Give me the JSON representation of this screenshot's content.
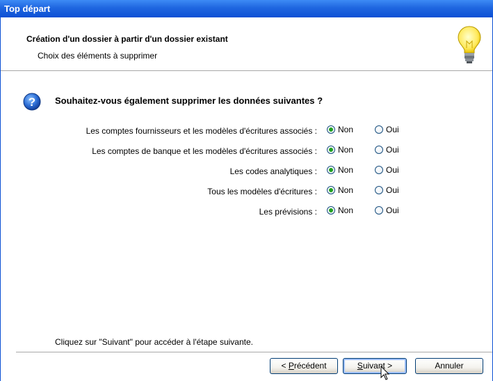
{
  "window": {
    "title": "Top départ"
  },
  "header": {
    "title": "Création d'un dossier à partir d'un dossier existant",
    "subtitle": "Choix des éléments à supprimer"
  },
  "question": "Souhaitez-vous également supprimer les données suivantes ?",
  "options": [
    {
      "label": "Les comptes fournisseurs et les modèles d'écritures associés :",
      "non": "Non",
      "oui": "Oui",
      "selected": "Non"
    },
    {
      "label": "Les comptes de banque et les modèles d'écritures associés :",
      "non": "Non",
      "oui": "Oui",
      "selected": "Non"
    },
    {
      "label": "Les codes analytiques :",
      "non": "Non",
      "oui": "Oui",
      "selected": "Non"
    },
    {
      "label": "Tous les modèles d'écritures :",
      "non": "Non",
      "oui": "Oui",
      "selected": "Non"
    },
    {
      "label": "Les prévisions :",
      "non": "Non",
      "oui": "Oui",
      "selected": "Non"
    }
  ],
  "footer": {
    "hint": "Cliquez sur \"Suivant\" pour accéder à l'étape suivante."
  },
  "buttons": {
    "previous": {
      "pre": "< ",
      "mnemonic": "P",
      "rest": "récédent"
    },
    "next": {
      "mnemonic": "S",
      "rest": "uivant >"
    },
    "cancel": "Annuler"
  },
  "colors": {
    "titlebar": "#0a4fd4",
    "radio_selected": "#21a121"
  }
}
